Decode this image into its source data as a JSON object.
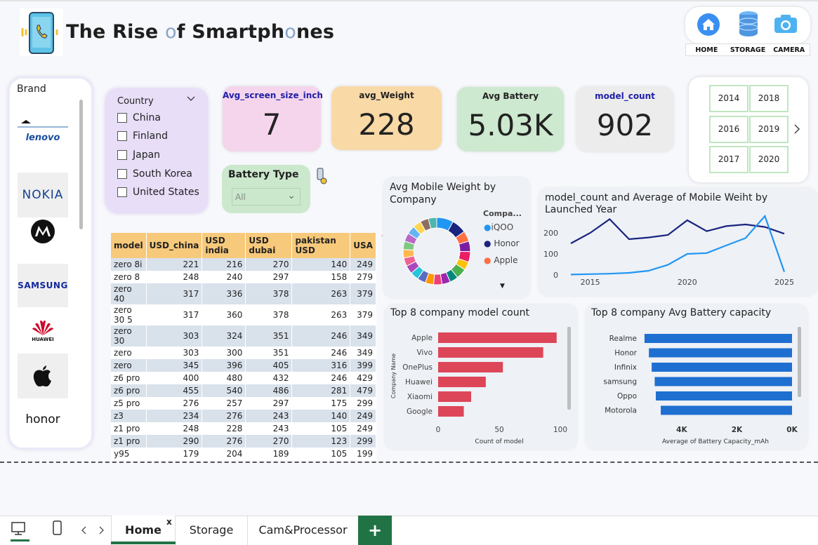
{
  "header": {
    "title_part1": "The Rise ",
    "title_o1": "o",
    "title_part2": "f Smartph",
    "title_o2": "o",
    "title_part3": "nes"
  },
  "nav": {
    "items": [
      {
        "label": "HOME",
        "icon": "home-icon"
      },
      {
        "label": "STORAGE",
        "icon": "database-icon"
      },
      {
        "label": "CAMERA",
        "icon": "camera-icon"
      }
    ]
  },
  "brand": {
    "label": "Brand",
    "items": [
      "lenovo",
      "NOKIA",
      "motorola",
      "SAMSUNG",
      "HUAWEI",
      "apple",
      "honor"
    ],
    "colors": {
      "lenovo": "#1a4fa0",
      "nokia": "#124191",
      "samsung": "#1428a0",
      "huawei": "#cf0a2c"
    }
  },
  "country": {
    "label": "Country",
    "options": [
      "China",
      "Finland",
      "Japan",
      "South Korea",
      "United States"
    ]
  },
  "kpis": [
    {
      "label": "Avg_screen_size_inch",
      "value": "7",
      "color": "#f5d5ec",
      "label_color": "#1f1fa8"
    },
    {
      "label": "avg_Weight",
      "value": "228",
      "color": "#f9d9a6",
      "label_color": "#222222"
    },
    {
      "label": "Avg Battery",
      "value": "5.03K",
      "color": "#cde9cf",
      "label_color": "#222222"
    },
    {
      "label": "model_count",
      "value": "902",
      "color": "#ececec",
      "label_color": "#1f1fa8"
    }
  ],
  "battery_type": {
    "label": "Battery Type",
    "value": "All"
  },
  "years": [
    "2014",
    "2018",
    "2016",
    "2019",
    "2017",
    "2020"
  ],
  "table": {
    "columns": [
      "model",
      "USD_china",
      "USD india",
      "USD dubai",
      "pakistan USD",
      "USA"
    ],
    "rows": [
      [
        "zero 8i",
        "221",
        "216",
        "270",
        "140",
        "249"
      ],
      [
        "zero 8",
        "248",
        "240",
        "297",
        "158",
        "279"
      ],
      [
        "zero 40",
        "317",
        "336",
        "378",
        "263",
        "379"
      ],
      [
        "zero 30 5",
        "317",
        "360",
        "378",
        "263",
        "379"
      ],
      [
        "zero 30",
        "303",
        "324",
        "351",
        "246",
        "349"
      ],
      [
        "zero",
        "303",
        "300",
        "351",
        "246",
        "349"
      ],
      [
        "zero",
        "345",
        "396",
        "405",
        "316",
        "399"
      ],
      [
        "z6 pro",
        "400",
        "480",
        "432",
        "246",
        "429"
      ],
      [
        "z6 pro",
        "455",
        "540",
        "486",
        "281",
        "479"
      ],
      [
        "z5 pro",
        "276",
        "257",
        "297",
        "175",
        "299"
      ],
      [
        "z3",
        "234",
        "276",
        "243",
        "140",
        "249"
      ],
      [
        "z1 pro",
        "248",
        "228",
        "243",
        "105",
        "249"
      ],
      [
        "z1 pro",
        "290",
        "276",
        "270",
        "123",
        "299"
      ],
      [
        "y95",
        "179",
        "204",
        "189",
        "105",
        "199"
      ]
    ]
  },
  "chart_data": [
    {
      "type": "pie",
      "title": "Avg Mobile Weight by Company",
      "legend_title": "Compa...",
      "legend": [
        {
          "name": "iQOO",
          "color": "#2196f3"
        },
        {
          "name": "Honor",
          "color": "#1a237e"
        },
        {
          "name": "Apple",
          "color": "#ff7043"
        }
      ],
      "slice_colors": [
        "#2196f3",
        "#1a237e",
        "#ff7043",
        "#7b1fa2",
        "#e91e63",
        "#ffc107",
        "#4caf50",
        "#00897b",
        "#9c27b0",
        "#ec407a",
        "#ff9800",
        "#5c6bc0",
        "#26c6da",
        "#ab47bc",
        "#f06292",
        "#ffb74d",
        "#81c784",
        "#ba68c8",
        "#64b5f6",
        "#ffd54f",
        "#8d6e63",
        "#4db6ac"
      ],
      "values": [
        8,
        7,
        5,
        5,
        5,
        4,
        5,
        4,
        4,
        4,
        4,
        4,
        4,
        4,
        4,
        4,
        4,
        4,
        4,
        4,
        4,
        4
      ]
    },
    {
      "type": "line",
      "title": "model_count and Average of Mobile Weiht by Launched Year",
      "x": [
        2014,
        2015,
        2016,
        2017,
        2018,
        2019,
        2020,
        2021,
        2022,
        2023,
        2024,
        2025
      ],
      "xticks": [
        "2015",
        "2020",
        "2025"
      ],
      "yticks": [
        "0",
        "100",
        "200"
      ],
      "ylim": [
        0,
        300
      ],
      "series": [
        {
          "name": "",
          "color": "#1a237e",
          "values": [
            150,
            200,
            265,
            170,
            178,
            190,
            260,
            208,
            232,
            240,
            228,
            196
          ]
        },
        {
          "name": "",
          "color": "#2196f3",
          "values": [
            2,
            4,
            6,
            10,
            20,
            48,
            100,
            104,
            140,
            175,
            280,
            15
          ]
        }
      ]
    },
    {
      "type": "bar",
      "title": "Top 8 company model count",
      "categories": [
        "Apple",
        "Vivo",
        "OnePlus",
        "Huawei",
        "Xiaomi",
        "Google"
      ],
      "values": [
        97,
        86,
        53,
        39,
        27,
        21
      ],
      "xlabel": "Count of model",
      "ylabel": "Company Name",
      "xticks": [
        "0",
        "50",
        "100"
      ],
      "xlim": [
        0,
        100
      ],
      "color": "#dd4658"
    },
    {
      "type": "bar",
      "title": "Top 8 company Avg Battery capacity",
      "categories": [
        "Realme",
        "Honor",
        "Infinix",
        "samsung",
        "Oppo",
        "Motorola"
      ],
      "values": [
        5350,
        5190,
        5090,
        4980,
        4940,
        4760
      ],
      "xlabel": "Average of Battery Capacity_mAh",
      "xticks": [
        "4K",
        "2K",
        "0K"
      ],
      "xlim": [
        0,
        5500
      ],
      "reversed": true,
      "color": "#1e6fd0"
    }
  ],
  "tabs": [
    {
      "label": "Home",
      "close": "x"
    },
    {
      "label": "Storage"
    },
    {
      "label": "Cam&Processor"
    }
  ],
  "add_tab": "+"
}
